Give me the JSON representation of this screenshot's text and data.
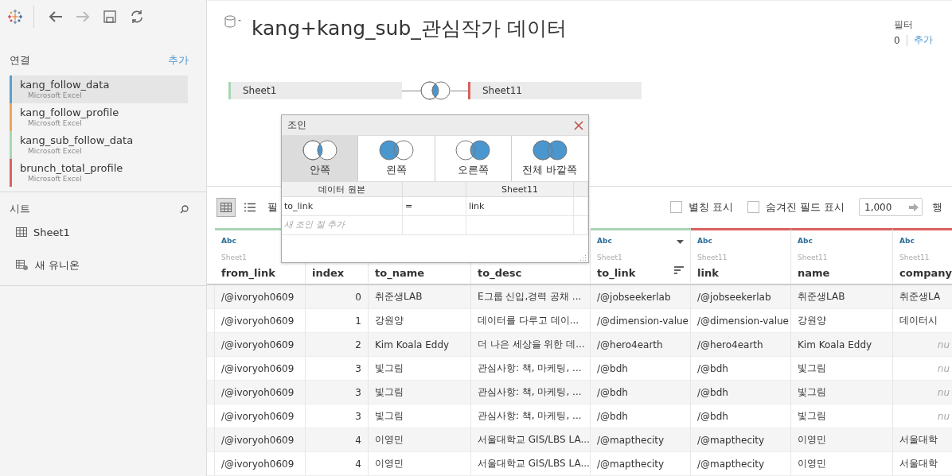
{
  "sidebar": {
    "toolbar": [
      {
        "kind": "back",
        "disabled": false
      },
      {
        "kind": "forward",
        "disabled": true
      },
      {
        "kind": "save",
        "disabled": false
      },
      {
        "kind": "refresh",
        "disabled": false
      }
    ],
    "connections_title": "연결",
    "connections_add": "추가",
    "connections": [
      {
        "name": "kang_follow_data",
        "type": "Microsoft Excel",
        "color": "#5b9fc9",
        "selected": true
      },
      {
        "name": "kang_follow_profile",
        "type": "Microsoft Excel",
        "color": "#f2a45a",
        "selected": false
      },
      {
        "name": "kang_sub_follow_data",
        "type": "Microsoft Excel",
        "color": "#a8d5b5",
        "selected": false
      },
      {
        "name": "brunch_total_profile",
        "type": "Microsoft Excel",
        "color": "#d9625f",
        "selected": false
      }
    ],
    "sheets_title": "시트",
    "sheets": [
      {
        "name": "Sheet1",
        "kind": "sheet"
      },
      {
        "name": "새 유니온",
        "kind": "union"
      }
    ]
  },
  "header": {
    "title": "kang+kang_sub_관심작가 데이터",
    "filter_label": "필터",
    "filter_count": "0",
    "filter_add": "추가"
  },
  "join": {
    "left": {
      "name": "Sheet1",
      "color": "#a8d5b5"
    },
    "right": {
      "name": "Sheet11",
      "color": "#d9625f"
    }
  },
  "join_dialog": {
    "title": "조인",
    "types": [
      {
        "label": "안쪽",
        "kind": "inner",
        "selected": true
      },
      {
        "label": "왼쪽",
        "kind": "left",
        "selected": false
      },
      {
        "label": "오른쪽",
        "kind": "right",
        "selected": false
      },
      {
        "label": "전체 바깥쪽",
        "kind": "full",
        "selected": false
      }
    ],
    "columns": [
      "데이터 원본",
      "",
      "Sheet11"
    ],
    "clauses": [
      {
        "left": "to_link",
        "op": "=",
        "right": "link"
      }
    ],
    "add_clause_placeholder": "새 조인 절 추가"
  },
  "toolbar": {
    "views": [
      {
        "kind": "grid",
        "selected": true
      },
      {
        "kind": "list",
        "selected": false
      }
    ],
    "fields_label": "필",
    "show_aliases": {
      "label": "별칭 표시",
      "checked": false
    },
    "show_hidden": {
      "label": "숨겨진 필드 표시",
      "checked": false
    },
    "rows_value": "1,000",
    "rows_label": "행"
  },
  "table": {
    "columns": [
      {
        "name": "from_link",
        "type": "Abc",
        "source": "Sheet1",
        "color": "#a8d5b5",
        "kind": "text"
      },
      {
        "name": "index",
        "kind": "number"
      },
      {
        "name": "to_name",
        "kind": "text"
      },
      {
        "name": "to_desc",
        "kind": "text"
      },
      {
        "name": "to_link",
        "type": "Abc",
        "source": "Sheet1",
        "color": "#a8d5b5",
        "kind": "text",
        "sorted": true
      },
      {
        "name": "link",
        "type": "Abc",
        "source": "Sheet11",
        "color": "#d9625f",
        "kind": "text"
      },
      {
        "name": "name",
        "type": "Abc",
        "source": "Sheet11",
        "color": "#d9625f",
        "kind": "text"
      },
      {
        "name": "company",
        "type": "Abc",
        "source": "Sheet11",
        "color": "#d9625f",
        "kind": "text"
      }
    ],
    "rows": [
      [
        "/@ivoryoh0609",
        "0",
        "취준생LAB",
        "E그룹 신입,경력 공채 ...",
        "/@jobseekerlab",
        "/@jobseekerlab",
        "취준생LAB",
        "취준생LA"
      ],
      [
        "/@ivoryoh0609",
        "1",
        "강원양",
        "데이터를 다루고 데이...",
        "/@dimension-value",
        "/@dimension-value",
        "강원양",
        "데이터시"
      ],
      [
        "/@ivoryoh0609",
        "2",
        "Kim Koala Eddy",
        "더 나은 세상을 위한 데...",
        "/@hero4earth",
        "/@hero4earth",
        "Kim Koala Eddy",
        {
          "text": "nu",
          "kind": "null"
        }
      ],
      [
        "/@ivoryoh0609",
        "3",
        "빛그림",
        "관심사항: 책, 마케팅, ...",
        "/@bdh",
        "/@bdh",
        "빛그림",
        {
          "text": "nu",
          "kind": "null"
        }
      ],
      [
        "/@ivoryoh0609",
        "3",
        "빛그림",
        "관심사항: 책, 마케팅, ...",
        "/@bdh",
        "/@bdh",
        "빛그림",
        {
          "text": "nu",
          "kind": "null"
        }
      ],
      [
        "/@ivoryoh0609",
        "3",
        "빛그림",
        "관심사항: 책, 마케팅, ...",
        "/@bdh",
        "/@bdh",
        "빛그림",
        {
          "text": "nu",
          "kind": "null"
        }
      ],
      [
        "/@ivoryoh0609",
        "4",
        "이영민",
        "서울대학교 GIS/LBS LA...",
        "/@mapthecity",
        "/@mapthecity",
        "이영민",
        "서울대학"
      ],
      [
        "/@ivoryoh0609",
        "4",
        "이영민",
        "서울대학교 GIS/LBS LA...",
        "/@mapthecity",
        "/@mapthecity",
        "이영민",
        "서울대학"
      ]
    ]
  }
}
